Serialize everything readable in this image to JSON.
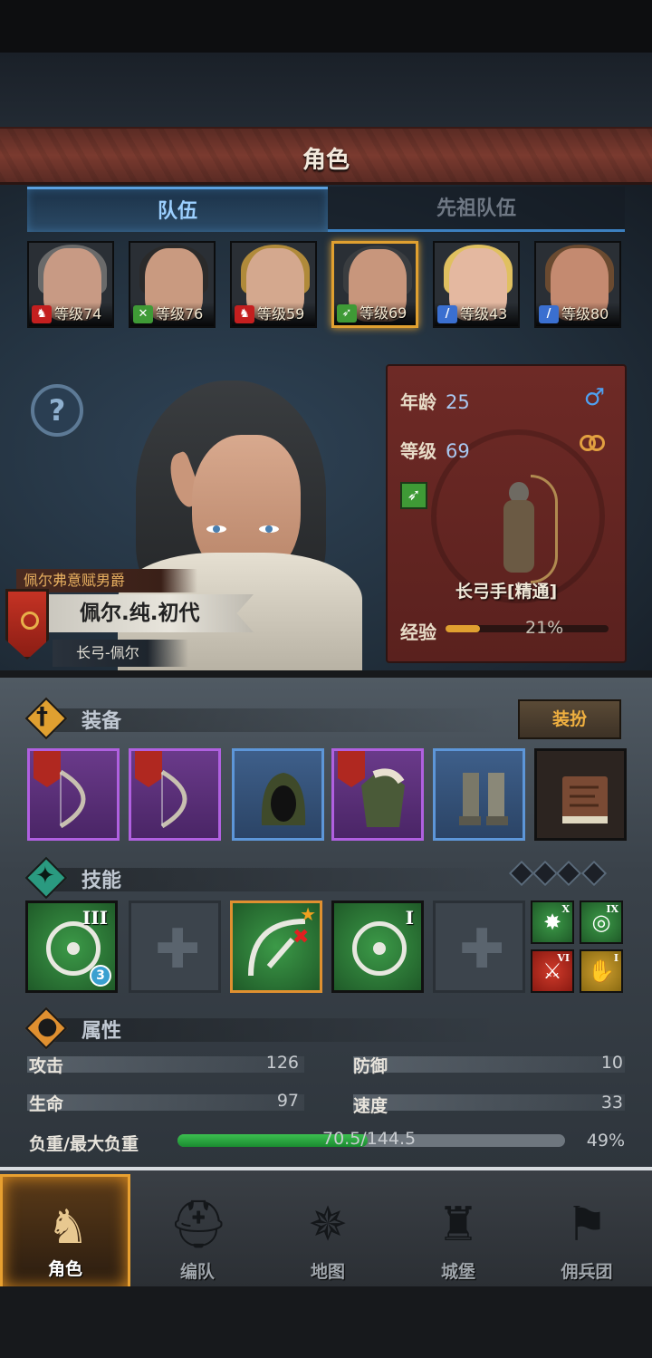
{
  "header": {
    "title": "角色"
  },
  "tabs": {
    "team": "队伍",
    "ancestor": "先祖队伍"
  },
  "roster": [
    {
      "level": "等级74",
      "class_icon": "horse-icon",
      "badge_color": "#c41f1f"
    },
    {
      "level": "等级76",
      "class_icon": "crossed-swords-icon",
      "badge_color": "#3f9a36"
    },
    {
      "level": "等级59",
      "class_icon": "horse-icon",
      "badge_color": "#c41f1f"
    },
    {
      "level": "等级69",
      "class_icon": "bow-icon",
      "badge_color": "#3f9a36",
      "selected": true
    },
    {
      "level": "等级43",
      "class_icon": "sword-icon",
      "badge_color": "#3a6fd0"
    },
    {
      "level": "等级80",
      "class_icon": "sword-icon",
      "badge_color": "#3a6fd0"
    }
  ],
  "character": {
    "title": "佩尔弗意赋男爵",
    "name": "佩尔.纯.初代",
    "subname": "长弓-佩尔",
    "age_label": "年龄",
    "age": "25",
    "level_label": "等级",
    "level": "69",
    "class_name": "长弓手[精通]",
    "exp_label": "经验",
    "exp_pct": "21%",
    "exp_fraction": 0.21
  },
  "equipment": {
    "title": "装备",
    "dress_button": "装扮",
    "items": [
      "longbow-icon",
      "longbow-icon",
      "hood-icon",
      "armor-icon",
      "boots-icon",
      "book-icon"
    ]
  },
  "skills": {
    "title": "技能",
    "main": [
      {
        "icon": "target-arrow-icon",
        "rank": "III",
        "count": "3"
      },
      {
        "icon": "empty-slot-icon"
      },
      {
        "icon": "bow-shot-icon"
      },
      {
        "icon": "target-icon",
        "rank": "I"
      },
      {
        "icon": "empty-slot-icon"
      }
    ],
    "mini": [
      {
        "icon": "burst-icon",
        "rank": "X"
      },
      {
        "icon": "target-icon",
        "rank": "IX"
      },
      {
        "icon": "sword-icon",
        "rank": "VI"
      },
      {
        "icon": "shield-hand-icon",
        "rank": "I"
      }
    ]
  },
  "attributes": {
    "title": "属性",
    "attack_label": "攻击",
    "attack": "126",
    "defense_label": "防御",
    "defense": "10",
    "hp_label": "生命",
    "hp": "97",
    "speed_label": "速度",
    "speed": "33",
    "load_label": "负重/最大负重",
    "load": "70.5/144.5",
    "load_pct": "49%",
    "load_fraction": 0.49
  },
  "nav": [
    {
      "label": "角色",
      "icon": "knight-icon",
      "active": true
    },
    {
      "label": "编队",
      "icon": "helmet-icon"
    },
    {
      "label": "地图",
      "icon": "compass-icon"
    },
    {
      "label": "城堡",
      "icon": "castle-icon"
    },
    {
      "label": "佣兵团",
      "icon": "mercenary-icon"
    }
  ],
  "colors": {
    "accent": "#e0a030",
    "header": "#7a3a2f",
    "tab_active": "#5aa0e0"
  }
}
